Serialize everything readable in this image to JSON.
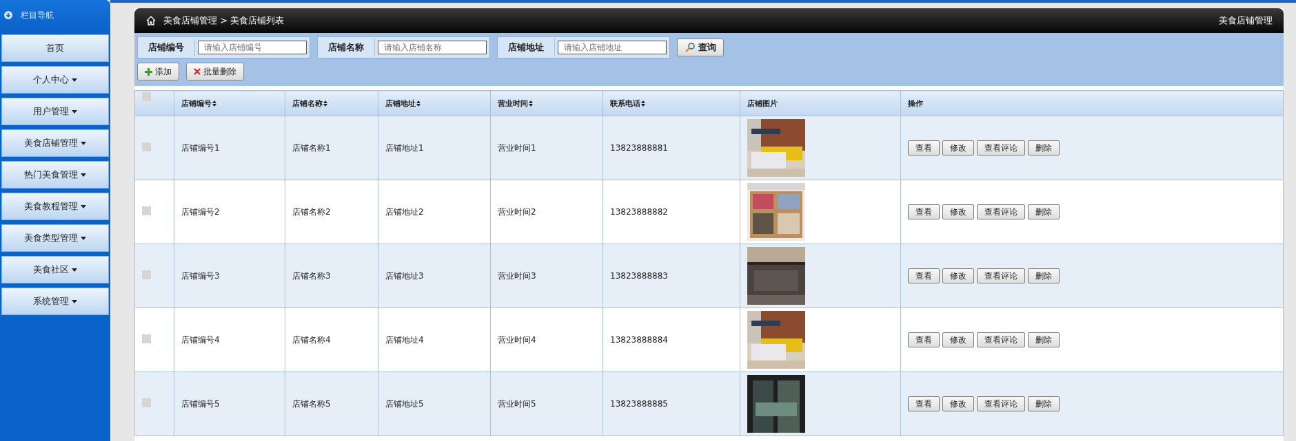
{
  "sidebar": {
    "title": "栏目导航",
    "items": [
      {
        "label": "首页",
        "has_menu": false
      },
      {
        "label": "个人中心",
        "has_menu": true
      },
      {
        "label": "用户管理",
        "has_menu": true
      },
      {
        "label": "美食店铺管理",
        "has_menu": true
      },
      {
        "label": "热门美食管理",
        "has_menu": true
      },
      {
        "label": "美食教程管理",
        "has_menu": true
      },
      {
        "label": "美食类型管理",
        "has_menu": true
      },
      {
        "label": "美食社区",
        "has_menu": true
      },
      {
        "label": "系统管理",
        "has_menu": true
      }
    ]
  },
  "header": {
    "breadcrumb": "美食店铺管理 > 美食店铺列表",
    "right_title": "美食店铺管理"
  },
  "search": {
    "fields": [
      {
        "label": "店铺编号",
        "placeholder": "请输入店铺编号"
      },
      {
        "label": "店铺名称",
        "placeholder": "请输入店铺名称"
      },
      {
        "label": "店铺地址",
        "placeholder": "请输入店铺地址"
      }
    ],
    "button": "查询"
  },
  "toolbar": [
    {
      "kind": "add",
      "label": "添加"
    },
    {
      "kind": "delete",
      "label": "批量删除"
    }
  ],
  "table": {
    "select_all_checked": false,
    "columns": [
      {
        "label": "店铺编号",
        "sortable": true
      },
      {
        "label": "店铺名称",
        "sortable": true
      },
      {
        "label": "店铺地址",
        "sortable": true
      },
      {
        "label": "营业时间",
        "sortable": true
      },
      {
        "label": "联系电话",
        "sortable": true
      },
      {
        "label": "店铺图片",
        "sortable": false
      },
      {
        "label": "操作",
        "sortable": false
      }
    ],
    "rows": [
      {
        "checked": false,
        "cells": [
          "店铺编号1",
          "店铺名称1",
          "店铺地址1",
          "营业时间1",
          "13823888881"
        ],
        "actions": [
          "查看",
          "修改",
          "查看评论",
          "删除"
        ]
      },
      {
        "checked": false,
        "cells": [
          "店铺编号2",
          "店铺名称2",
          "店铺地址2",
          "营业时间2",
          "13823888882"
        ],
        "actions": [
          "查看",
          "修改",
          "查看评论",
          "删除"
        ]
      },
      {
        "checked": false,
        "cells": [
          "店铺编号3",
          "店铺名称3",
          "店铺地址3",
          "营业时间3",
          "13823888883"
        ],
        "actions": [
          "查看",
          "修改",
          "查看评论",
          "删除"
        ]
      },
      {
        "checked": false,
        "cells": [
          "店铺编号4",
          "店铺名称4",
          "店铺地址4",
          "营业时间4",
          "13823888884"
        ],
        "actions": [
          "查看",
          "修改",
          "查看评论",
          "删除"
        ]
      },
      {
        "checked": false,
        "cells": [
          "店铺编号5",
          "店铺名称5",
          "店铺地址5",
          "营业时间5",
          "13823888885"
        ],
        "actions": [
          "查看",
          "修改",
          "查看评论",
          "删除"
        ]
      }
    ]
  }
}
